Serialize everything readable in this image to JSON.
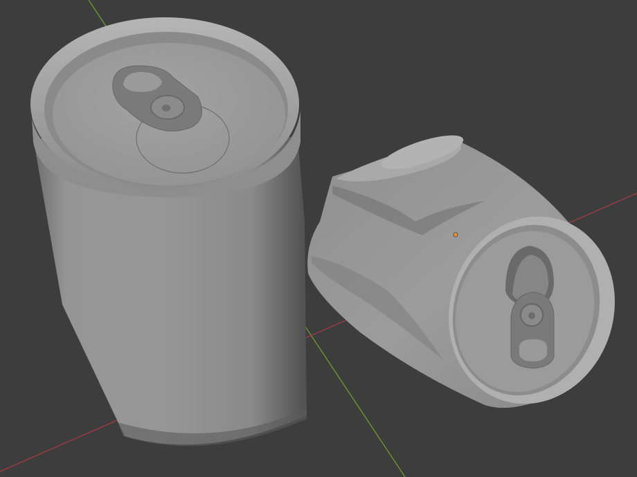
{
  "viewport": {
    "background": "#3d3d3d",
    "x_axis_color": "#a33a45",
    "y_axis_color": "#6f9b2f",
    "origin_color": "#f0962a",
    "grid_color": "#454545"
  },
  "objects": [
    {
      "name": "Can",
      "state": "upright"
    },
    {
      "name": "CrushedCan",
      "state": "crushed"
    }
  ]
}
